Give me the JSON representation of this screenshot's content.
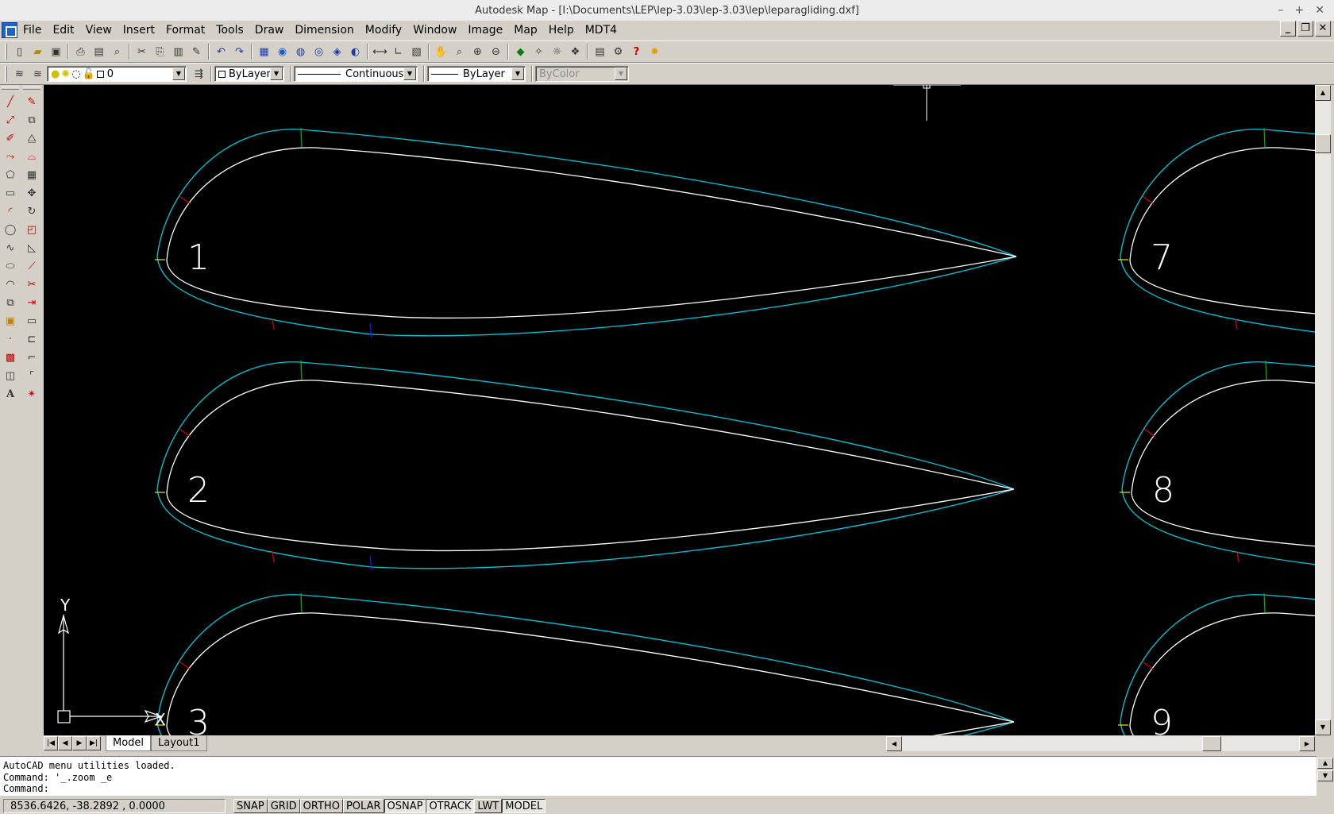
{
  "window": {
    "title": "Autodesk Map - [I:\\Documents\\LEP\\lep-3.03\\lep-3.03\\lep\\leparagliding.dxf]",
    "controls": [
      "–",
      "+",
      "✕"
    ]
  },
  "menu": [
    "File",
    "Edit",
    "View",
    "Insert",
    "Format",
    "Tools",
    "Draw",
    "Dimension",
    "Modify",
    "Window",
    "Image",
    "Map",
    "Help",
    "MDT4"
  ],
  "properties_toolbar": {
    "layer": "0",
    "color": "ByLayer",
    "linetype": "Continuous",
    "lineweight": "ByLayer",
    "plotstyle": "ByColor"
  },
  "drawing": {
    "profile_labels": [
      "1",
      "2",
      "3",
      "7",
      "8",
      "9"
    ],
    "ucs": {
      "x_label": "X",
      "y_label": "Y"
    },
    "colors": {
      "outer": "#00c8d8",
      "inner": "#ffffff",
      "mark_green": "#00b000",
      "mark_red": "#d00000",
      "mark_blue": "#1020e0",
      "mark_yellow": "#d8d800",
      "background": "#000000"
    }
  },
  "tabs": [
    "Model",
    "Layout1"
  ],
  "active_tab": "Model",
  "command_lines": [
    "AutoCAD menu utilities loaded.",
    "Command: '_.zoom _e",
    "Command:"
  ],
  "status": {
    "coords": "8536.6426, -38.2892 , 0.0000",
    "toggles": [
      {
        "label": "SNAP",
        "on": false
      },
      {
        "label": "GRID",
        "on": false
      },
      {
        "label": "ORTHO",
        "on": false
      },
      {
        "label": "POLAR",
        "on": false
      },
      {
        "label": "OSNAP",
        "on": true
      },
      {
        "label": "OTRACK",
        "on": true
      },
      {
        "label": "LWT",
        "on": false
      },
      {
        "label": "MODEL",
        "on": true
      }
    ]
  }
}
